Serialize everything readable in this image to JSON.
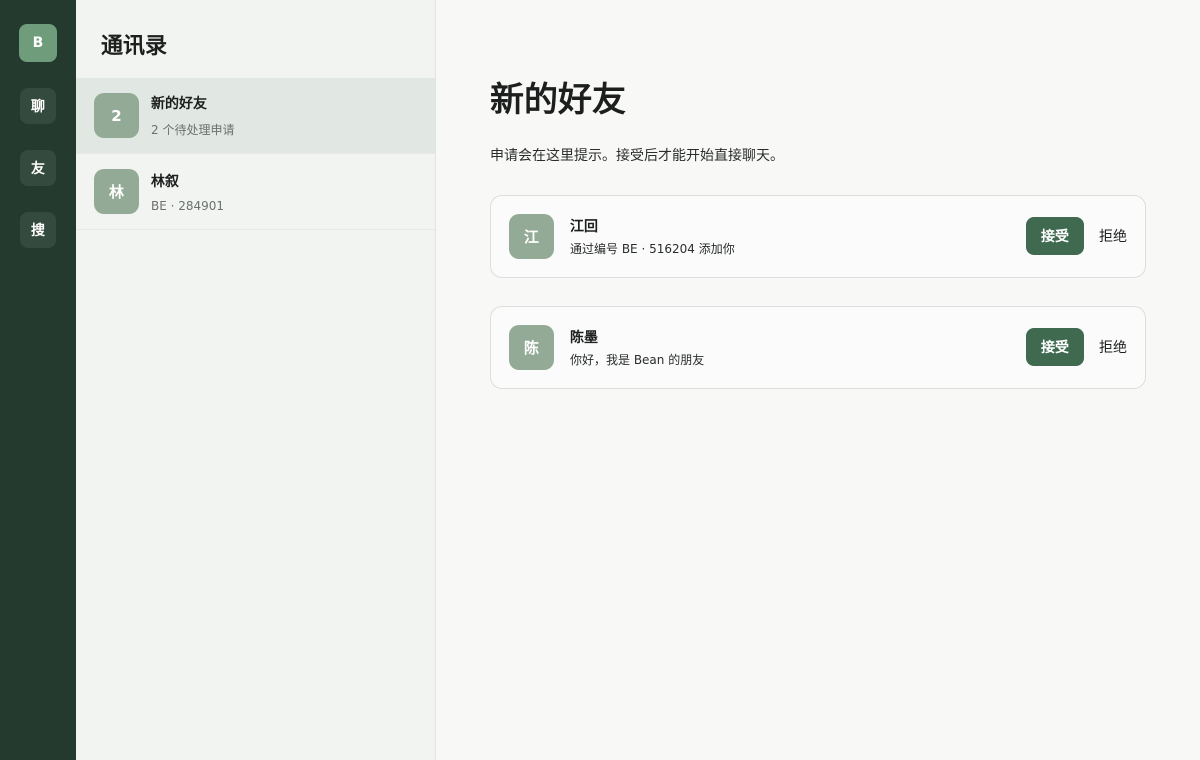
{
  "rail": {
    "avatar": "B",
    "items": [
      {
        "label": "聊"
      },
      {
        "label": "友"
      },
      {
        "label": "搜"
      }
    ]
  },
  "contacts": {
    "title": "通讯录",
    "items": [
      {
        "avatar": "2",
        "name": "新的好友",
        "sub": "2 个待处理申请"
      },
      {
        "avatar": "林",
        "name": "林叙",
        "sub": "BE · 284901"
      }
    ]
  },
  "main": {
    "title": "新的好友",
    "description": "申请会在这里提示。接受后才能开始直接聊天。",
    "requests": [
      {
        "avatar": "江",
        "name": "江回",
        "message": "通过编号 BE · 516204 添加你",
        "accept_label": "接受",
        "reject_label": "拒绝"
      },
      {
        "avatar": "陈",
        "name": "陈墨",
        "message": "你好，我是 Bean 的朋友",
        "accept_label": "接受",
        "reject_label": "拒绝"
      }
    ]
  },
  "colors": {
    "rail_bg": "#243a2e",
    "accent": "#3f6a50",
    "avatar_bg": "#93ab96",
    "active_item_bg": "#e1e7e2"
  }
}
